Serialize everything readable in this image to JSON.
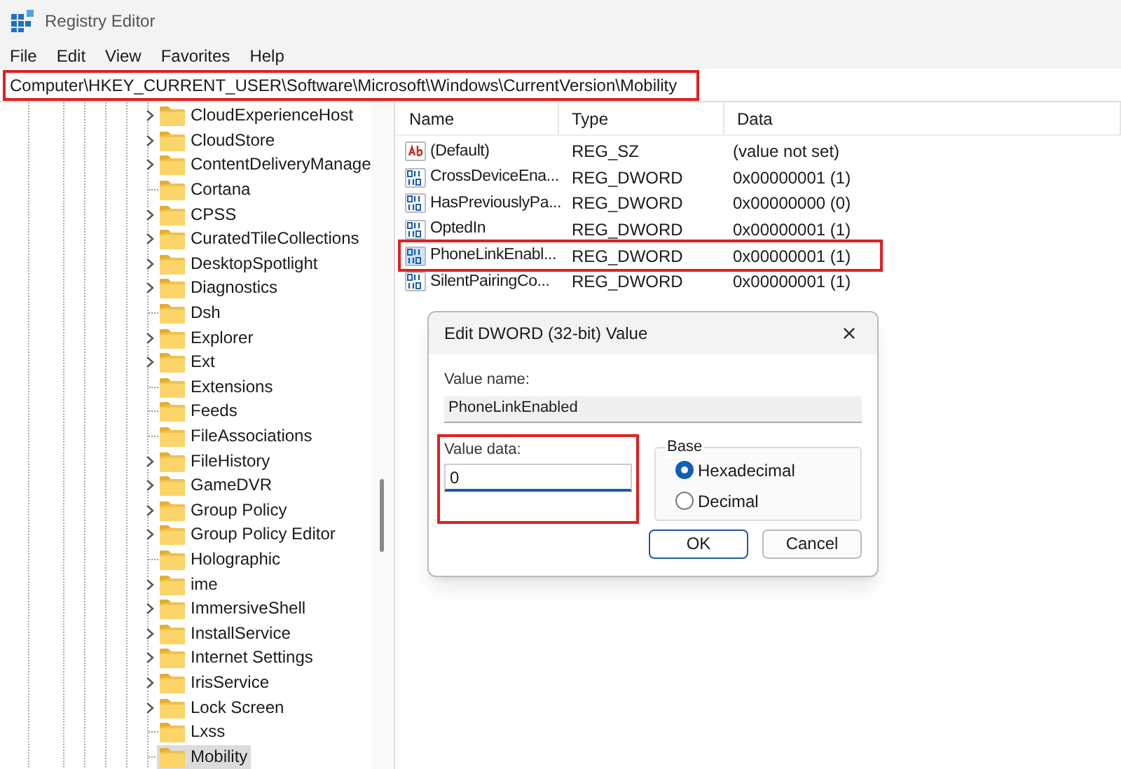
{
  "window": {
    "title": "Registry Editor"
  },
  "menu": [
    "File",
    "Edit",
    "View",
    "Favorites",
    "Help"
  ],
  "address_bar": {
    "value": "Computer\\HKEY_CURRENT_USER\\Software\\Microsoft\\Windows\\CurrentVersion\\Mobility",
    "highlighted": true
  },
  "tree": [
    {
      "label": "CloudExperienceHost",
      "expandable": true,
      "selected": false
    },
    {
      "label": "CloudStore",
      "expandable": true,
      "selected": false
    },
    {
      "label": "ContentDeliveryManage",
      "expandable": true,
      "selected": false
    },
    {
      "label": "Cortana",
      "expandable": false,
      "selected": false
    },
    {
      "label": "CPSS",
      "expandable": true,
      "selected": false
    },
    {
      "label": "CuratedTileCollections",
      "expandable": true,
      "selected": false
    },
    {
      "label": "DesktopSpotlight",
      "expandable": true,
      "selected": false
    },
    {
      "label": "Diagnostics",
      "expandable": true,
      "selected": false
    },
    {
      "label": "Dsh",
      "expandable": false,
      "selected": false
    },
    {
      "label": "Explorer",
      "expandable": true,
      "selected": false
    },
    {
      "label": "Ext",
      "expandable": true,
      "selected": false
    },
    {
      "label": "Extensions",
      "expandable": false,
      "selected": false
    },
    {
      "label": "Feeds",
      "expandable": false,
      "selected": false
    },
    {
      "label": "FileAssociations",
      "expandable": false,
      "selected": false
    },
    {
      "label": "FileHistory",
      "expandable": true,
      "selected": false
    },
    {
      "label": "GameDVR",
      "expandable": true,
      "selected": false
    },
    {
      "label": "Group Policy",
      "expandable": true,
      "selected": false
    },
    {
      "label": "Group Policy Editor",
      "expandable": true,
      "selected": false
    },
    {
      "label": "Holographic",
      "expandable": false,
      "selected": false
    },
    {
      "label": "ime",
      "expandable": true,
      "selected": false
    },
    {
      "label": "ImmersiveShell",
      "expandable": true,
      "selected": false
    },
    {
      "label": "InstallService",
      "expandable": true,
      "selected": false
    },
    {
      "label": "Internet Settings",
      "expandable": true,
      "selected": false
    },
    {
      "label": "IrisService",
      "expandable": true,
      "selected": false
    },
    {
      "label": "Lock Screen",
      "expandable": true,
      "selected": false
    },
    {
      "label": "Lxss",
      "expandable": false,
      "selected": false
    },
    {
      "label": "Mobility",
      "expandable": false,
      "selected": true
    }
  ],
  "values_table": {
    "columns": [
      "Name",
      "Type",
      "Data"
    ],
    "rows": [
      {
        "kind": "string",
        "name": "(Default)",
        "type": "REG_SZ",
        "data": "(value not set)",
        "highlighted": false
      },
      {
        "kind": "binary",
        "name": "CrossDeviceEna...",
        "type": "REG_DWORD",
        "data": "0x00000001 (1)",
        "highlighted": false
      },
      {
        "kind": "binary",
        "name": "HasPreviouslyPa...",
        "type": "REG_DWORD",
        "data": "0x00000000 (0)",
        "highlighted": false
      },
      {
        "kind": "binary",
        "name": "OptedIn",
        "type": "REG_DWORD",
        "data": "0x00000001 (1)",
        "highlighted": false
      },
      {
        "kind": "binary",
        "name": "PhoneLinkEnabl...",
        "type": "REG_DWORD",
        "data": "0x00000001 (1)",
        "highlighted": true
      },
      {
        "kind": "binary",
        "name": "SilentPairingCo...",
        "type": "REG_DWORD",
        "data": "0x00000001 (1)",
        "highlighted": false
      }
    ]
  },
  "dialog": {
    "title": "Edit DWORD (32-bit) Value",
    "close": "×",
    "value_name_label": "Value name:",
    "value_name": "PhoneLinkEnabled",
    "value_data_label": "Value data:",
    "value_data": "0",
    "value_data_highlighted": true,
    "base_label": "Base",
    "base_options": [
      {
        "label": "Hexadecimal",
        "selected": true
      },
      {
        "label": "Decimal",
        "selected": false
      }
    ],
    "buttons": [
      "OK",
      "Cancel"
    ]
  }
}
